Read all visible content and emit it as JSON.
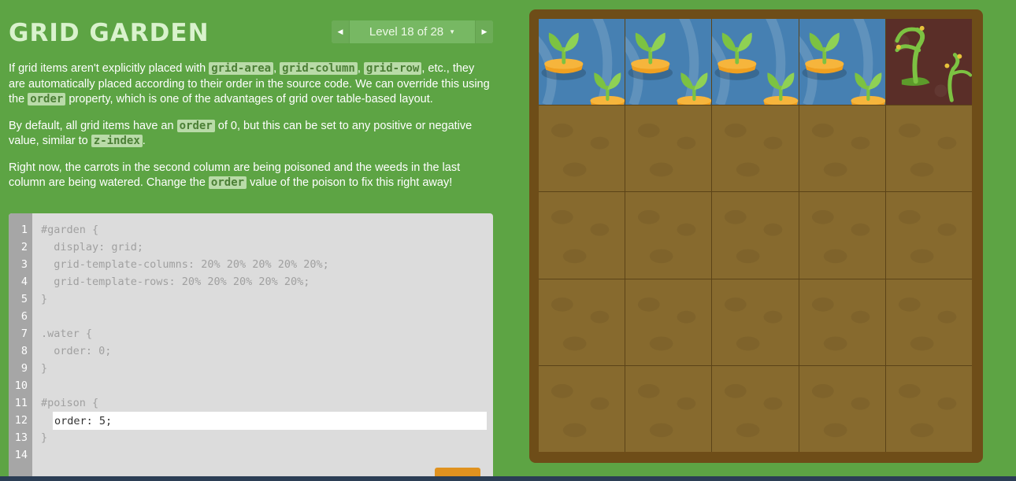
{
  "header": {
    "title": "GRID GARDEN",
    "level_label": "Level 18 of 28",
    "prev_arrow": "◀",
    "next_arrow": "▶",
    "caret": "▼"
  },
  "instructions": {
    "p1": {
      "t1": "If grid items aren't explicitly placed with ",
      "c1": "grid-area",
      "t2": ", ",
      "c2": "grid-column",
      "t3": ", ",
      "c3": "grid-row",
      "t4": ", etc., they are automatically placed according to their order in the source code. We can override this using the ",
      "c4": "order",
      "t5": " property, which is one of the advantages of grid over table-based layout."
    },
    "p2": {
      "t1": "By default, all grid items have an ",
      "c1": "order",
      "t2": " of 0, but this can be set to any positive or negative value, similar to ",
      "c2": "z-index",
      "t3": "."
    },
    "p3": {
      "t1": "Right now, the carrots in the second column are being poisoned and the weeds in the last column are being watered. Change the ",
      "c1": "order",
      "t2": " value of the poison to fix this right away!"
    }
  },
  "editor": {
    "lines": [
      {
        "num": "1",
        "text": "#garden {"
      },
      {
        "num": "2",
        "text": "  display: grid;"
      },
      {
        "num": "3",
        "text": "  grid-template-columns: 20% 20% 20% 20% 20%;"
      },
      {
        "num": "4",
        "text": "  grid-template-rows: 20% 20% 20% 20% 20%;"
      },
      {
        "num": "5",
        "text": "}"
      },
      {
        "num": "6",
        "text": ""
      },
      {
        "num": "7",
        "text": ".water {"
      },
      {
        "num": "8",
        "text": "  order: 0;"
      },
      {
        "num": "9",
        "text": "}"
      },
      {
        "num": "10",
        "text": ""
      },
      {
        "num": "11",
        "text": "#poison {"
      },
      {
        "num": "12",
        "text": ""
      },
      {
        "num": "13",
        "text": "}"
      },
      {
        "num": "14",
        "text": ""
      }
    ],
    "input_value": "order: 5;"
  },
  "garden": {
    "cells": [
      "water",
      "water",
      "water",
      "water",
      "poison",
      "soil",
      "soil",
      "soil",
      "soil",
      "soil",
      "soil",
      "soil",
      "soil",
      "soil",
      "soil",
      "soil",
      "soil",
      "soil",
      "soil",
      "soil",
      "soil",
      "soil",
      "soil",
      "soil",
      "soil"
    ],
    "colors": {
      "water": "#4680b2",
      "soil": "#876a2e",
      "poison": "#5a2e28",
      "carrot": "#f0a020",
      "leaf": "#7cc242"
    }
  }
}
